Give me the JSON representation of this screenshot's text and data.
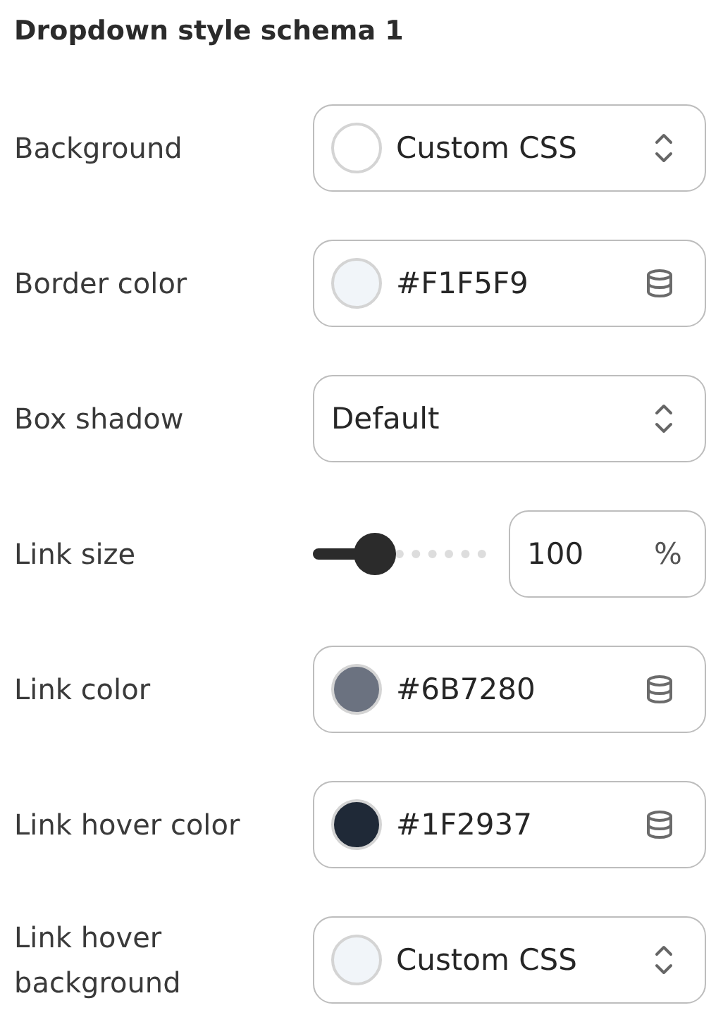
{
  "title": "Dropdown style schema 1",
  "rows": [
    {
      "label": "Background",
      "kind": "swatch-select",
      "color": "#ffffff",
      "value": "Custom CSS"
    },
    {
      "label": "Border color",
      "kind": "color",
      "color": "#f1f5f9",
      "value": "#F1F5F9"
    },
    {
      "label": "Box shadow",
      "kind": "select",
      "value": "Default"
    },
    {
      "label": "Link size",
      "kind": "slider",
      "level": 0.36,
      "value": "100",
      "unit": "%"
    },
    {
      "label": "Link color",
      "kind": "color",
      "color": "#6b7280",
      "value": "#6B7280"
    },
    {
      "label": "Link hover color",
      "kind": "color",
      "color": "#1f2937",
      "value": "#1F2937"
    },
    {
      "label": "Link hover background",
      "kind": "swatch-select",
      "color": "#f1f5f9",
      "value": "Custom CSS"
    }
  ]
}
